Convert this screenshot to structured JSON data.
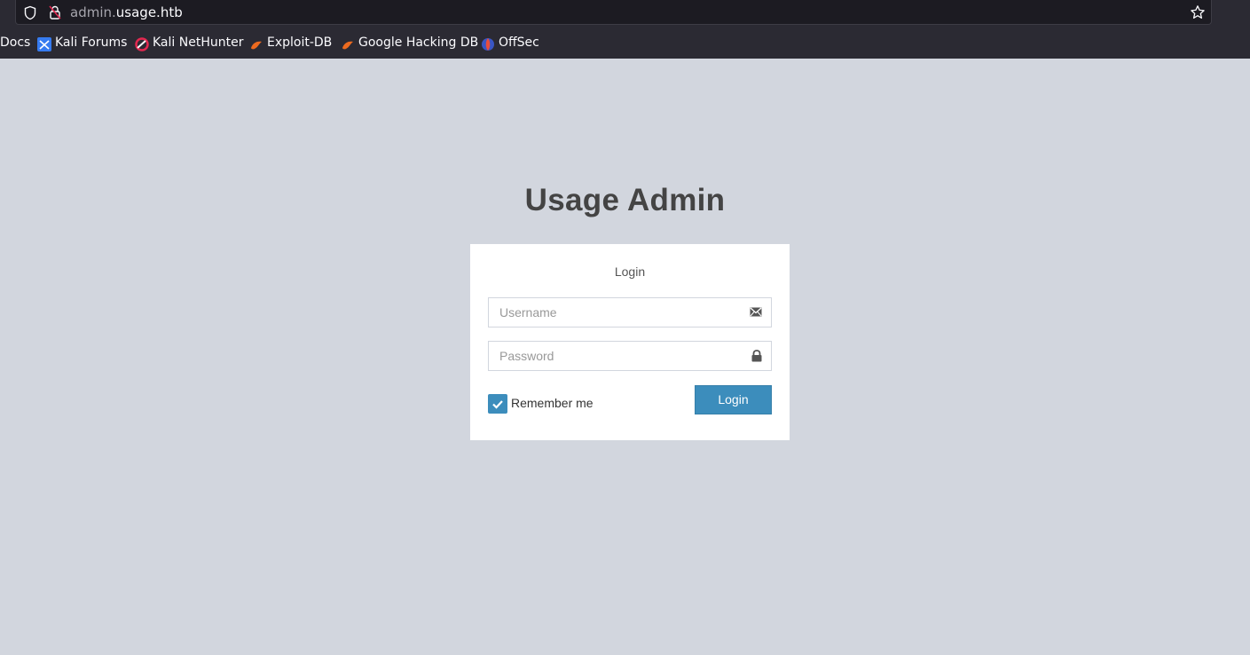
{
  "browser": {
    "url_subdomain": "admin.",
    "url_domain": "usage.htb",
    "bookmarks": [
      {
        "label": "Docs",
        "icon": "none"
      },
      {
        "label": "Kali Forums",
        "icon": "kali-forums-icon"
      },
      {
        "label": "Kali NetHunter",
        "icon": "kali-nethunter-icon"
      },
      {
        "label": "Exploit-DB",
        "icon": "exploit-db-icon"
      },
      {
        "label": "Google Hacking DB",
        "icon": "exploit-db-icon"
      },
      {
        "label": "OffSec",
        "icon": "offsec-icon"
      }
    ]
  },
  "page": {
    "title": "Usage Admin",
    "box_message": "Login",
    "username_placeholder": "Username",
    "password_placeholder": "Password",
    "remember_label": "Remember me",
    "remember_checked": true,
    "login_button": "Login"
  },
  "colors": {
    "page_background": "#d2d6de",
    "primary_button": "#3c8dbc",
    "browser_chrome": "#2b2a33"
  }
}
